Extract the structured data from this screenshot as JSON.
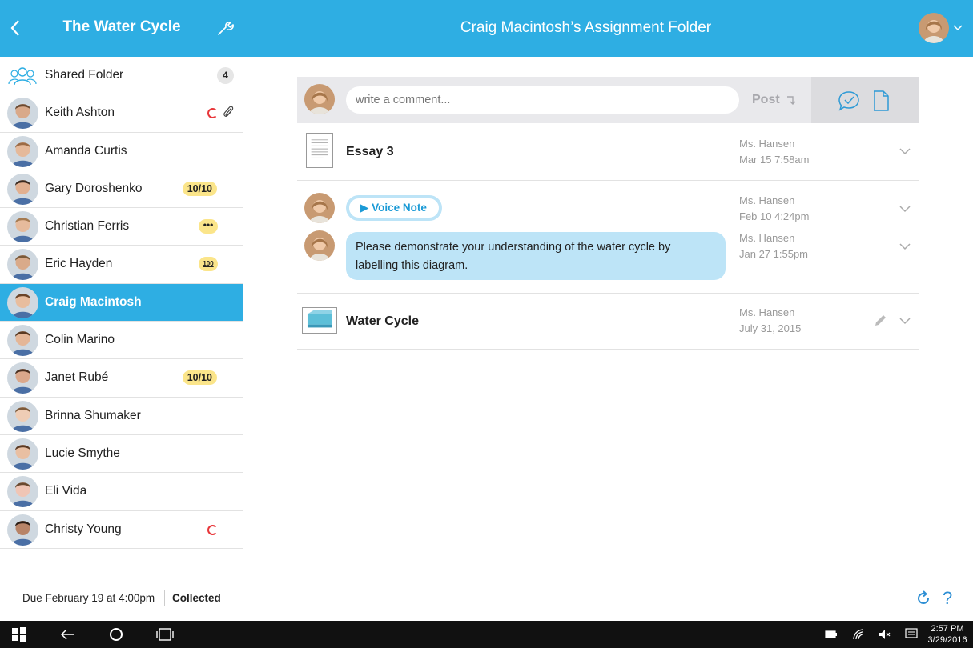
{
  "sidebar": {
    "title": "The Water Cycle",
    "shared_folder": {
      "label": "Shared Folder",
      "count": "4"
    },
    "students": [
      {
        "name": "Keith Ashton",
        "status": "ring-clip",
        "skin": "#d9a98a",
        "hair": "#6a4a32"
      },
      {
        "name": "Amanda Curtis",
        "status": "",
        "skin": "#e5b99a",
        "hair": "#9c6b45"
      },
      {
        "name": "Gary Doroshenko",
        "status": "score",
        "score": "10/10",
        "skin": "#e2b090",
        "hair": "#3a2a20"
      },
      {
        "name": "Christian Ferris",
        "status": "dots",
        "dots": "•••",
        "skin": "#e6bb9c",
        "hair": "#a57a50"
      },
      {
        "name": "Eric Hayden",
        "status": "hundred",
        "hundred": "100",
        "skin": "#d9aa8a",
        "hair": "#7a5a3a"
      },
      {
        "name": "Craig Macintosh",
        "status": "",
        "selected": true,
        "skin": "#e8bd9e",
        "hair": "#6b4428"
      },
      {
        "name": "Colin Marino",
        "status": "",
        "skin": "#e4b697",
        "hair": "#5a3a22"
      },
      {
        "name": "Janet Rubé",
        "status": "score",
        "score": "10/10",
        "skin": "#dba88b",
        "hair": "#4a3020"
      },
      {
        "name": "Brinna Shumaker",
        "status": "",
        "skin": "#efcdb5",
        "hair": "#7d5a3a"
      },
      {
        "name": "Lucie Smythe",
        "status": "",
        "skin": "#e9bfa2",
        "hair": "#5a3a24"
      },
      {
        "name": "Eli Vida",
        "status": "",
        "skin": "#f0c5b5",
        "hair": "#6a4a30"
      },
      {
        "name": "Christy Young",
        "status": "ring",
        "skin": "#b88468",
        "hair": "#2a1c14"
      }
    ],
    "footer": {
      "due": "Due February 19 at 4:00pm",
      "collected": "Collected"
    }
  },
  "header": {
    "title": "Craig Macintosh’s Assignment Folder"
  },
  "composer": {
    "placeholder": "write a comment...",
    "post_label": "Post"
  },
  "items": {
    "essay": {
      "title": "Essay 3",
      "author": "Ms. Hansen",
      "date": "Mar 15 7:58am"
    },
    "voice": {
      "label": "Voice Note",
      "author": "Ms. Hansen",
      "date": "Feb 10 4:24pm"
    },
    "message": {
      "text": "Please demonstrate your understanding of the water cycle by labelling this diagram.",
      "author": "Ms. Hansen",
      "date": "Jan 27 1:55pm"
    },
    "water": {
      "title": "Water Cycle",
      "author": "Ms. Hansen",
      "date": "July 31, 2015"
    }
  },
  "footer_icons": {
    "help": "?"
  },
  "taskbar": {
    "time": "2:57 PM",
    "date": "3/29/2016"
  },
  "colors": {
    "accent": "#2eaee3",
    "score_badge": "#fbe58a",
    "bubble": "#bde4f7",
    "alert": "#e8373b"
  }
}
